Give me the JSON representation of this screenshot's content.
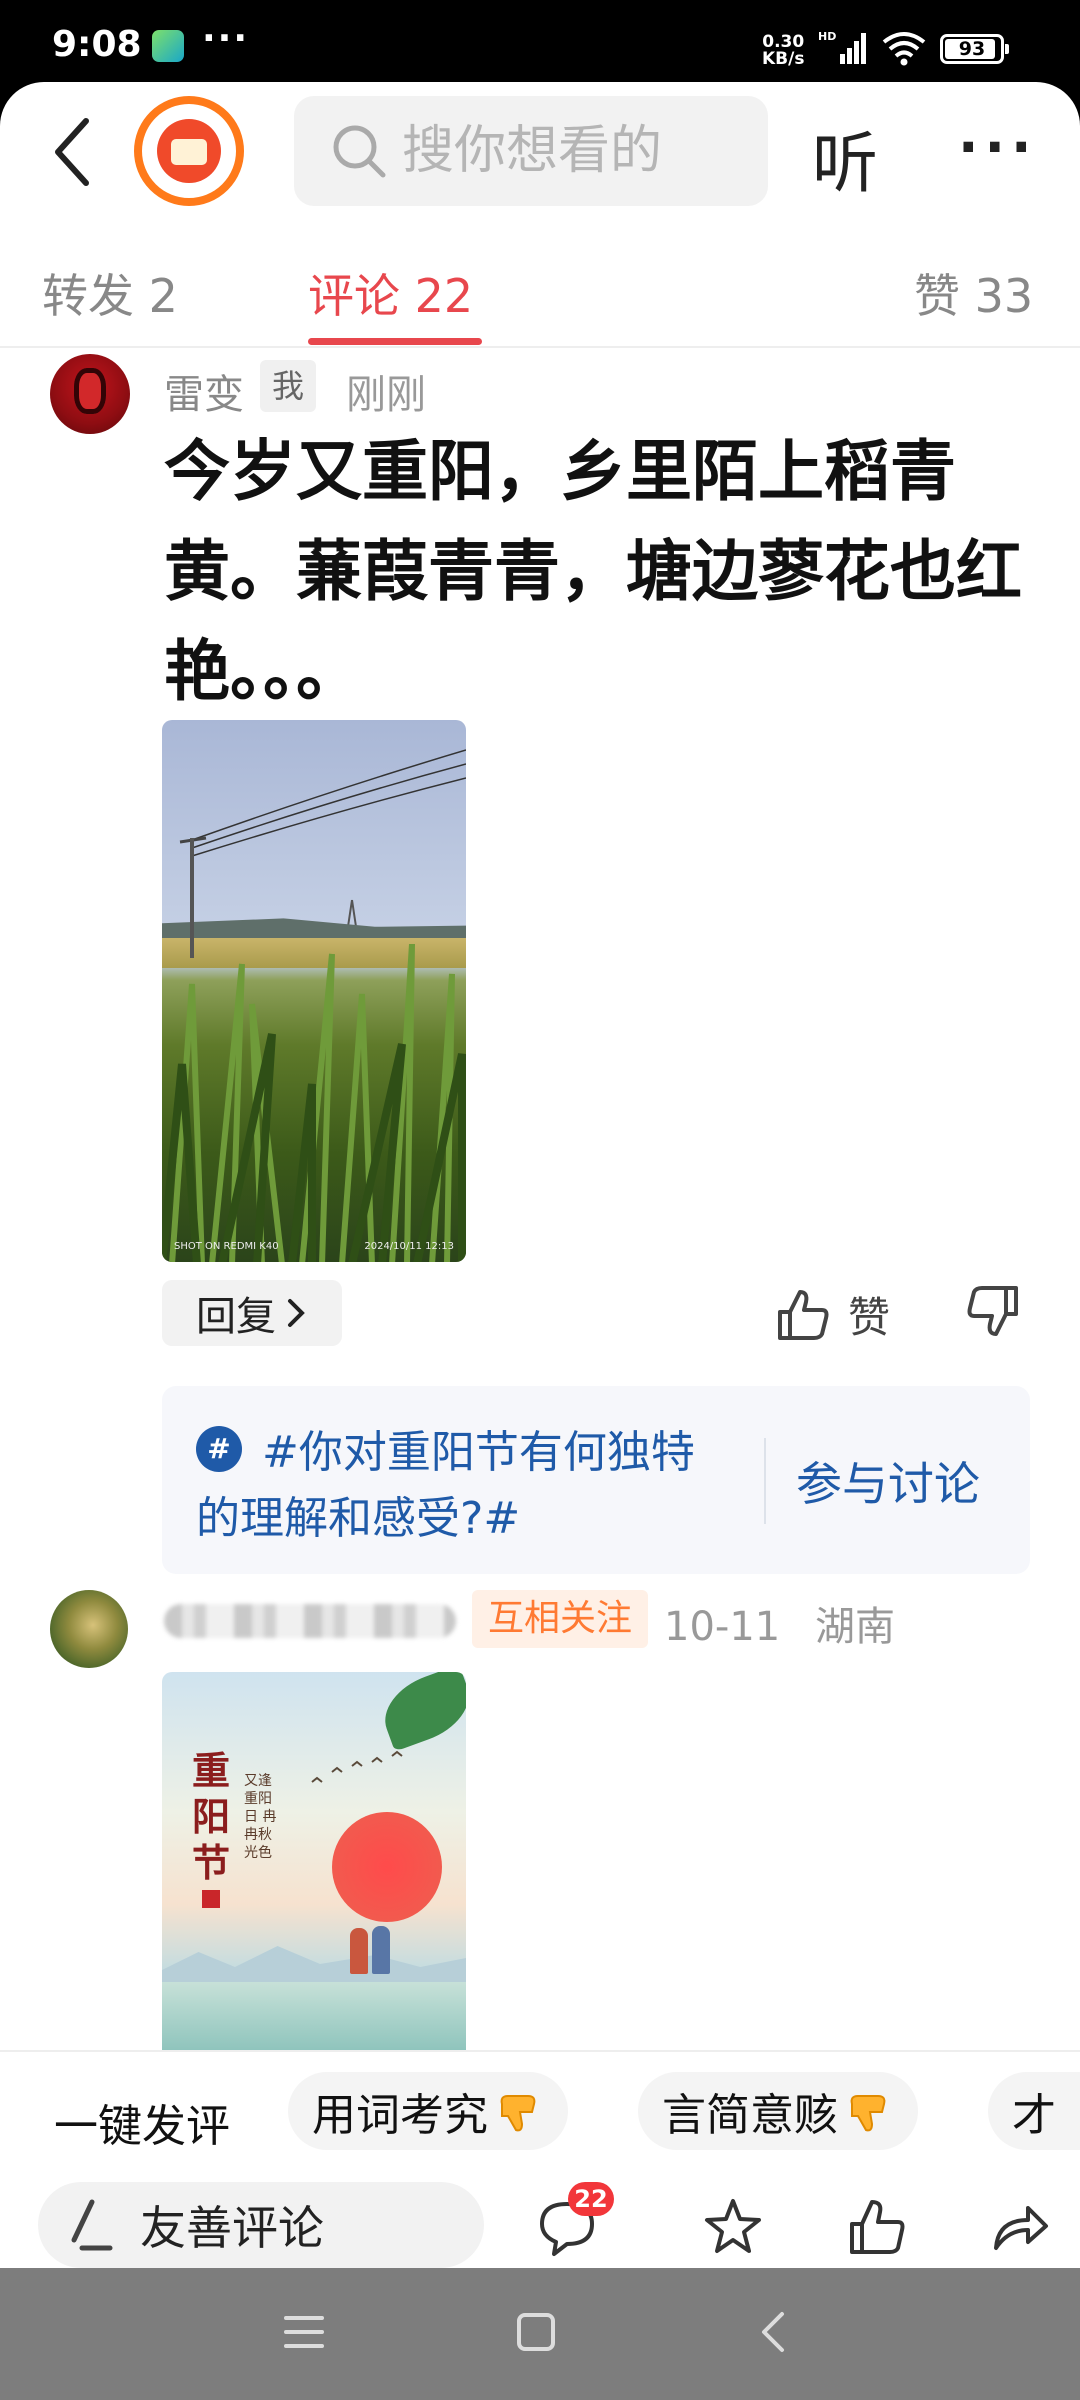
{
  "status_bar": {
    "time": "9:08",
    "more": "···",
    "speed_value": "0.30",
    "speed_unit": "KB/s",
    "hd": "HD",
    "battery": "93",
    "battery_level": 0.93
  },
  "header": {
    "search_placeholder": "搜你想看的",
    "listen_label": "听",
    "more_label": "···"
  },
  "tabs": [
    {
      "label": "转发 2"
    },
    {
      "label": "评论 22",
      "active": true
    },
    {
      "label": "赞 33"
    }
  ],
  "comments": [
    {
      "username": "雷变",
      "me_badge": "我",
      "time": "刚刚",
      "text": "今岁又重阳，乡里陌上稻青黄。蒹葭青青，塘边蓼花也红艳。。。",
      "photo_watermark_left": "SHOT ON REDMI K40",
      "photo_watermark_right": "2024/10/11 12:13",
      "reply_label": "回复",
      "like_label": "赞"
    },
    {
      "relation_badge": "互相关注",
      "date": "10-11",
      "location": "湖南",
      "photo_title": "重阳节",
      "photo_poem": "又逢重阳日 冉冉秋光色"
    }
  ],
  "topic": {
    "icon": "#",
    "text": "#你对重阳节有何独特的理解和感受?#",
    "join_label": "参与讨论"
  },
  "quick_reply": {
    "label": "一键发评",
    "chips": [
      "用词考究",
      "言简意赅",
      "才"
    ]
  },
  "bottom_bar": {
    "comment_placeholder": "友善评论",
    "comment_count": "22"
  },
  "colors": {
    "accent": "#e8474d",
    "topic_blue": "#1f5aa8",
    "badge_red": "#f2363a",
    "mutual_orange": "#ff7a33",
    "nav_gray": "#7d7d7d"
  }
}
